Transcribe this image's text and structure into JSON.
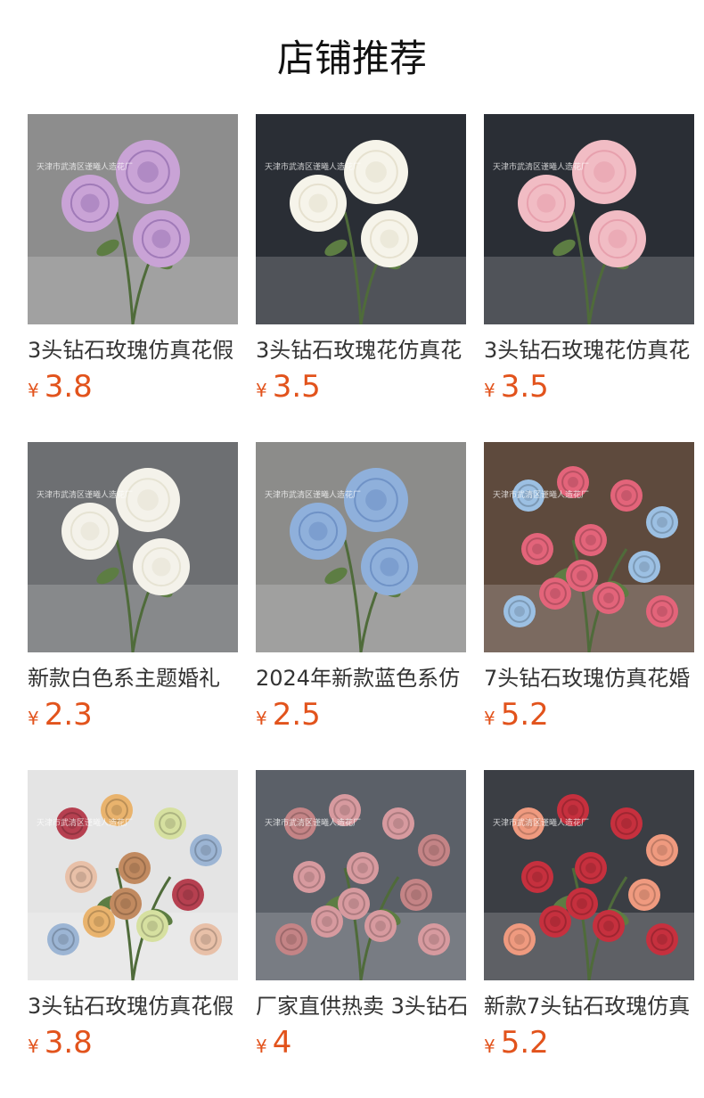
{
  "section_title": "店铺推荐",
  "products": [
    {
      "name": "3头钻石玫瑰仿真花假",
      "currency": "¥",
      "price": "3.8",
      "image": "purple-rose-bouquet-image",
      "bg": "#8d8d8d",
      "flower": "#c9a3d6",
      "accent": "#a07ab8",
      "cols": 1
    },
    {
      "name": "3头钻石玫瑰花仿真花",
      "currency": "¥",
      "price": "3.5",
      "image": "white-rose-bouquet-image",
      "bg": "#2a2e35",
      "flower": "#f6f4ea",
      "accent": "#e6e1cf",
      "cols": 1
    },
    {
      "name": "3头钻石玫瑰花仿真花",
      "currency": "¥",
      "price": "3.5",
      "image": "pink-rose-bouquet-image",
      "bg": "#2a2e35",
      "flower": "#f1bcc4",
      "accent": "#e7a0ad",
      "cols": 1
    },
    {
      "name": "新款白色系主题婚礼",
      "currency": "¥",
      "price": "2.3",
      "image": "white-hydrangea-image",
      "bg": "#6d6f72",
      "flower": "#f4f2ea",
      "accent": "#e6e3d3",
      "cols": 1
    },
    {
      "name": "2024年新款蓝色系仿",
      "currency": "¥",
      "price": "2.5",
      "image": "blue-peony-image",
      "bg": "#8c8c8a",
      "flower": "#8fb0db",
      "accent": "#6f92c6",
      "cols": 1
    },
    {
      "name": "7头钻石玫瑰仿真花婚",
      "currency": "¥",
      "price": "5.2",
      "image": "mixed-rose-branches-image",
      "bg": "#5e4a3d",
      "flower": "#e3647a",
      "accent": "#9cc0e3",
      "cols": 2
    },
    {
      "name": "3头钻石玫瑰仿真花假",
      "currency": "¥",
      "price": "3.8",
      "image": "assorted-rose-colors-image",
      "bg": "#e4e4e4",
      "flower": "#b64050",
      "accent": "#e9b36d",
      "cols": 3
    },
    {
      "name": "厂家直供热卖 3头钻石",
      "currency": "¥",
      "price": "4",
      "image": "rose-vase-arrangement-image",
      "bg": "#5b6068",
      "flower": "#d79a9f",
      "accent": "#c48486",
      "cols": 2
    },
    {
      "name": "新款7头钻石玫瑰仿真",
      "currency": "¥",
      "price": "5.2",
      "image": "red-rose-bunch-image",
      "bg": "#3b3e44",
      "flower": "#c6303e",
      "accent": "#ef9a7f",
      "cols": 2
    }
  ],
  "watermark": "天津市武清区谨曦人造花厂"
}
